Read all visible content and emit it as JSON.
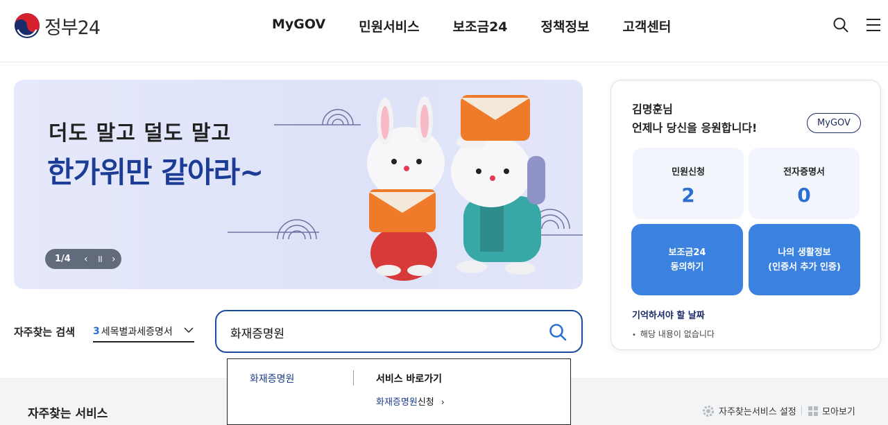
{
  "header": {
    "logo_text": "정부24",
    "nav": [
      "MyGOV",
      "민원서비스",
      "보조금24",
      "정책정보",
      "고객센터"
    ],
    "icons": [
      "search-icon",
      "menu-icon"
    ]
  },
  "banner": {
    "line1": "더도 말고 덜도 말고",
    "line2": "한가위만 같아라~",
    "counter": "1/4",
    "colors": {
      "headline": "#1d3c96",
      "background": "#e0e4f9"
    }
  },
  "profile": {
    "name": "김명훈님",
    "greeting": "언제나 당신을 응원합니다!",
    "mygov_button": "MyGOV",
    "civil_label": "민원신청",
    "civil_count": "2",
    "cert_label": "전자증명서",
    "cert_count": "0",
    "subsidy_line1": "보조금24",
    "subsidy_line2": "동의하기",
    "life_line1": "나의 생활정보",
    "life_line2": "(인증서 추가 인증)",
    "remember_title": "기억하셔야 할 날짜",
    "remember_empty": "해당 내용이 없습니다",
    "accent": "#3b82e0"
  },
  "search": {
    "label": "자주찾는 검색",
    "select_num": "3",
    "select_text": "세목별과세증명서",
    "query": "화재증명원"
  },
  "autocomplete": {
    "keyword": "화재증명원",
    "heading": "서비스 바로가기",
    "link_highlight": "화재증명원",
    "link_rest": "신청"
  },
  "faq": {
    "title": "자주찾는 서비스",
    "setting": "자주찾는서비스 설정",
    "collect": "모아보기"
  }
}
